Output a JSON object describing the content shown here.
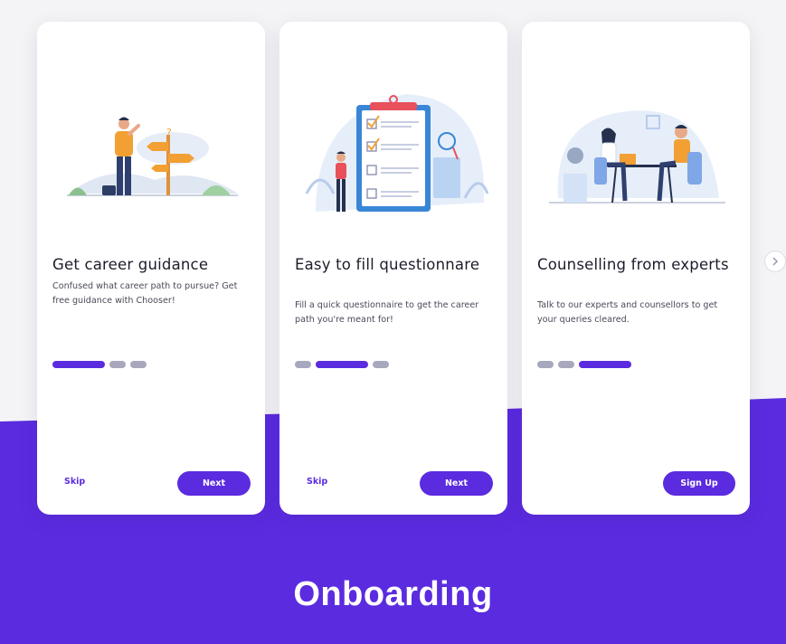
{
  "colors": {
    "accent": "#5b2be0",
    "card_bg": "#ffffff",
    "page_bg": "#f4f4f6",
    "dot_inactive": "#a7a8bd",
    "text_dark": "#1d1d2b"
  },
  "cards": [
    {
      "illustration": "career-signpost-illustration",
      "title": "Get career guidance",
      "description": "Confused what career path to pursue? Get free guidance with Chooser!",
      "active_step": 1,
      "total_steps": 3,
      "skip_label": "Skip",
      "primary_label": "Next"
    },
    {
      "illustration": "questionnaire-clipboard-illustration",
      "title": "Easy to fill questionnare",
      "description": "Fill a quick questionnaire to get the career path you're meant for!",
      "active_step": 2,
      "total_steps": 3,
      "skip_label": "Skip",
      "primary_label": "Next"
    },
    {
      "illustration": "counselling-meeting-illustration",
      "title": "Counselling from experts",
      "description": "Talk to our experts and counsellors to get your queries cleared.",
      "active_step": 3,
      "total_steps": 3,
      "primary_label": "Sign Up"
    }
  ],
  "carousel": {
    "next_icon": "chevron-right-icon"
  },
  "heading": "Onboarding"
}
